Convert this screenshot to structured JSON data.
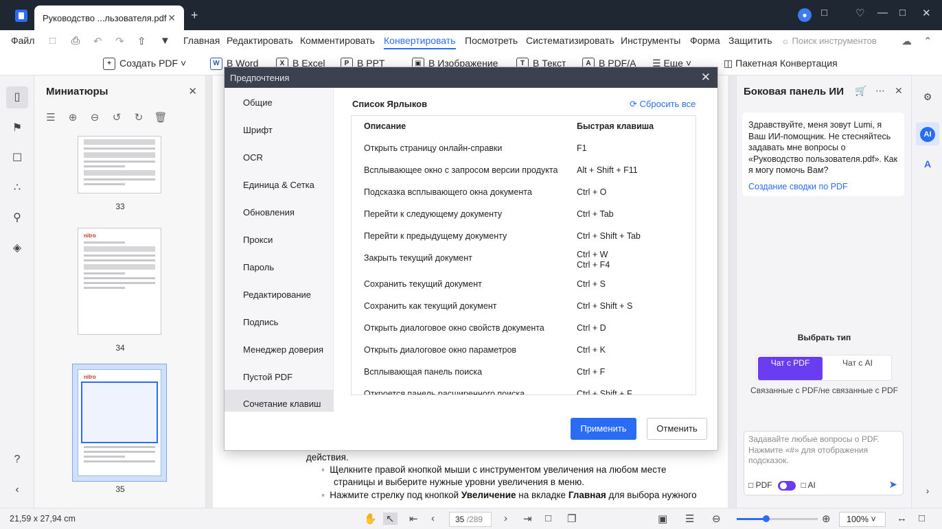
{
  "titlebar": {
    "tab_title": "Руководство ...льзователя.pdf",
    "tab_close": "✕",
    "new_tab": "+"
  },
  "menu": {
    "file": "Файл",
    "items": [
      "Главная",
      "Редактировать",
      "Комментировать",
      "Конвертировать",
      "Посмотреть",
      "Систематизировать",
      "Инструменты",
      "Форма",
      "Защитить"
    ],
    "active": "Конвертировать",
    "search_placeholder": "Поиск инструментов"
  },
  "toolbar": {
    "create_pdf": "Создать PDF",
    "to_word": "В Word",
    "to_excel": "В Excel",
    "to_ppt": "В PPT",
    "to_image": "В Изображение",
    "to_text": "В Текст",
    "to_pdfa": "В PDF/A",
    "more": "Еще",
    "batch": "Пакетная Конвертация"
  },
  "thumbnails": {
    "title": "Миниатюры",
    "pages": [
      {
        "number": "33"
      },
      {
        "number": "34"
      },
      {
        "number": "35"
      }
    ],
    "logo": "nitro"
  },
  "document": {
    "lines": [
      "действия.",
      "Щелкните правой кнопкой мыши с инструментом увеличения на любом месте",
      "страницы и выберите нужные уровни увеличения в меню."
    ],
    "last_line": {
      "pre": "Нажмите стрелку под кнопкой ",
      "bold1": "Увеличение",
      "mid": " на вкладке ",
      "bold2": "Главная",
      "post": " для выбора нужного"
    }
  },
  "dialog": {
    "title": "Предпочтения",
    "nav": [
      "Общие",
      "Шрифт",
      "OCR",
      "Единица & Сетка",
      "Обновления",
      "Прокси",
      "Пароль",
      "Редактирование",
      "Подпись",
      "Менеджер доверия",
      "Пустой PDF",
      "Сочетание клавиш"
    ],
    "active_nav": "Сочетание клавиш",
    "section_title": "Список Ярлыков",
    "reset_label": "Сбросить все",
    "columns": {
      "description": "Описание",
      "shortcut": "Быстрая клавиша"
    },
    "rows": [
      {
        "desc": "Открыть страницу онлайн-справки",
        "key": "F1"
      },
      {
        "desc": "Всплывающее окно с запросом версии продукта",
        "key": "Alt + Shift + F11"
      },
      {
        "desc": "Подсказка всплывающего окна документа",
        "key": "Ctrl + O"
      },
      {
        "desc": "Перейти к следующему документу",
        "key": "Ctrl + Tab"
      },
      {
        "desc": "Перейти к предыдущему документу",
        "key": "Ctrl + Shift + Tab"
      },
      {
        "desc": "Закрыть текущий документ",
        "key": "Ctrl + W",
        "key2": "Ctrl + F4"
      },
      {
        "desc": "Сохранить текущий документ",
        "key": "Ctrl + S"
      },
      {
        "desc": "Сохранить как текущий документ",
        "key": "Ctrl + Shift + S"
      },
      {
        "desc": "Открыть диалоговое окно свойств документа",
        "key": "Ctrl + D"
      },
      {
        "desc": "Открыть диалоговое окно параметров",
        "key": "Ctrl + K"
      },
      {
        "desc": "Всплывающая панель поиска",
        "key": "Ctrl + F"
      },
      {
        "desc": "Откроется панель расширенного поиска",
        "key": "Ctrl + Shift + F"
      }
    ],
    "apply": "Применить",
    "cancel": "Отменить"
  },
  "ai_panel": {
    "title": "Боковая панель ИИ",
    "greeting": "Здравствуйте, меня зовут Lumi, я Ваш ИИ-помощник. Не стесняйтесь задавать мне вопросы о «Руководство пользователя.pdf». Как я могу помочь Вам?",
    "summary_link": "Создание сводки по PDF",
    "choose_type": "Выбрать тип",
    "option_pdf": "Чат с PDF",
    "option_ai": "Чат с AI",
    "subtitle": "Связанные с PDF/не связанные с PDF",
    "input_placeholder": "Задавайте любые вопросы о PDF. Нажмите «#» для отображения подсказок.",
    "toggle_left": "PDF",
    "toggle_right": "AI"
  },
  "right_rail": {
    "ai_badge": "AI"
  },
  "statusbar": {
    "page_size": "21,59 x 27,94 cm",
    "current_page": "35",
    "total_pages": "/289",
    "zoom": "100%"
  },
  "colors": {
    "accent": "#2a6df4",
    "ai_purple": "#6a3df0",
    "titlebar": "#1f2733"
  }
}
